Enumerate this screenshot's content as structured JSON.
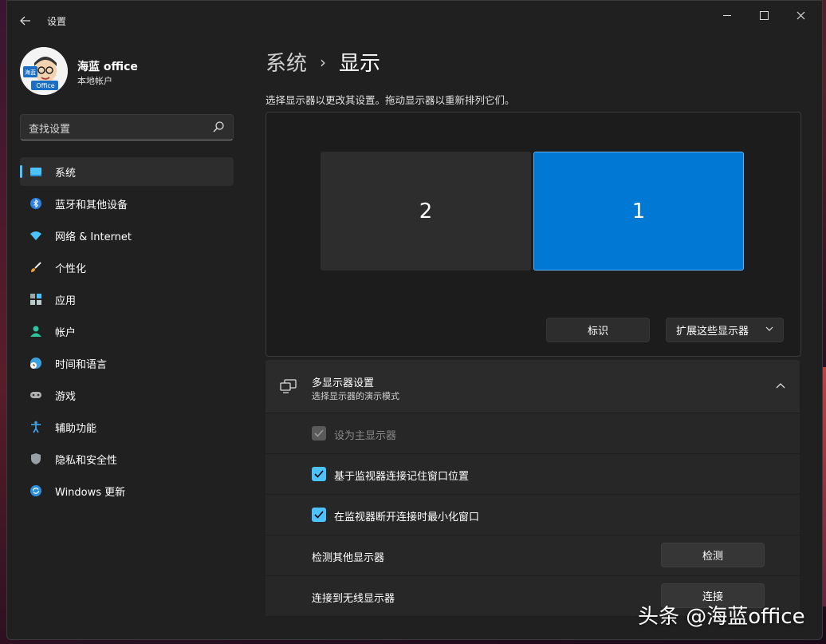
{
  "window": {
    "title": "设置"
  },
  "user": {
    "name": "海蓝 office",
    "account_type": "本地帐户",
    "avatar_text_top": "海蓝",
    "avatar_text_bottom": "Office"
  },
  "search": {
    "placeholder": "查找设置"
  },
  "sidebar": {
    "items": [
      {
        "label": "系统",
        "icon": "system-icon",
        "active": true
      },
      {
        "label": "蓝牙和其他设备",
        "icon": "bluetooth-icon"
      },
      {
        "label": "网络 & Internet",
        "icon": "wifi-icon"
      },
      {
        "label": "个性化",
        "icon": "brush-icon"
      },
      {
        "label": "应用",
        "icon": "apps-icon"
      },
      {
        "label": "帐户",
        "icon": "account-icon"
      },
      {
        "label": "时间和语言",
        "icon": "globe-clock-icon"
      },
      {
        "label": "游戏",
        "icon": "gamepad-icon"
      },
      {
        "label": "辅助功能",
        "icon": "accessibility-icon"
      },
      {
        "label": "隐私和安全性",
        "icon": "shield-icon"
      },
      {
        "label": "Windows 更新",
        "icon": "update-icon"
      }
    ]
  },
  "breadcrumb": {
    "parent": "系统",
    "current": "显示"
  },
  "description": "选择显示器以更改其设置。拖动显示器以重新排列它们。",
  "monitors": {
    "secondary": "2",
    "primary": "1"
  },
  "display_actions": {
    "identify": "标识",
    "mode": "扩展这些显示器"
  },
  "multi_display": {
    "title": "多显示器设置",
    "subtitle": "选择显示器的演示模式",
    "rows": {
      "set_primary": "设为主显示器",
      "remember_positions": "基于监视器连接记住窗口位置",
      "minimize_on_disconnect": "在监视器断开连接时最小化窗口",
      "detect_label": "检测其他显示器",
      "detect_button": "检测",
      "wireless_label": "连接到无线显示器",
      "wireless_button": "连接"
    }
  },
  "watermark": "头条 @海蓝office",
  "colors": {
    "accent": "#4cc2ff",
    "primary_monitor": "#0078d4",
    "window_bg": "#202020"
  }
}
